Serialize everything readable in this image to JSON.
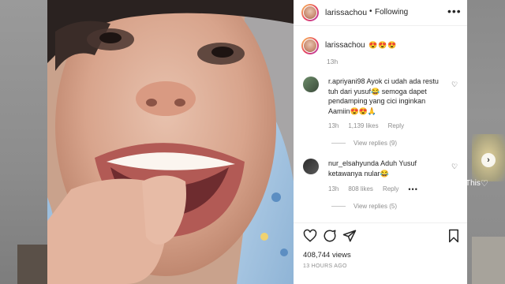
{
  "post": {
    "username": "larissachou",
    "follow_dot": "•",
    "follow_label": "Following",
    "more_label": "•••",
    "caption_username": "larissachou",
    "caption_text": "😍😍😍",
    "caption_time": "13h"
  },
  "comments": [
    {
      "username": "r.apriyani98",
      "text": "Ayok ci udah ada restu tuh dari yusuf😂 semoga dapet pendamping yang cici inginkan Aamiin😍😍🙏",
      "time": "13h",
      "likes": "1,139 likes",
      "reply": "Reply",
      "view_replies": "View replies (9)"
    },
    {
      "username": "nur_elsahyunda",
      "text": "Aduh Yusuf ketawanya nular😂",
      "time": "13h",
      "likes": "808 likes",
      "reply": "Reply",
      "more": "•••",
      "view_replies": "View replies (5)"
    }
  ],
  "stats": {
    "views": "408,744 views",
    "time_ago": "13 HOURS AGO"
  },
  "background": {
    "side_text": "This"
  },
  "icons": {
    "like": "heart-icon",
    "comment": "comment-icon",
    "share": "share-icon",
    "save": "bookmark-icon",
    "next": "chevron-right-icon"
  }
}
